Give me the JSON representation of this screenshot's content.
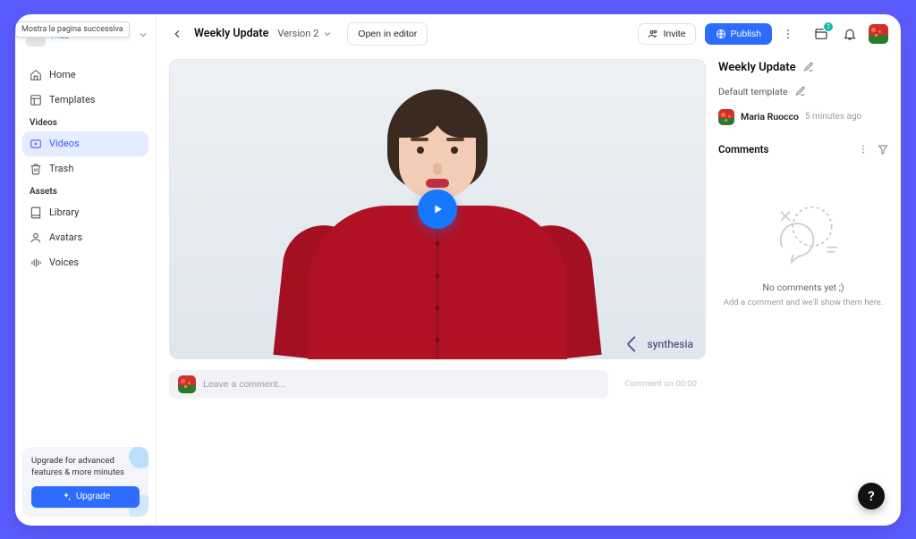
{
  "tooltip": "Mostra la pagina successiva",
  "workspace": {
    "plan": "FREE"
  },
  "nav": {
    "home": "Home",
    "templates": "Templates",
    "videos_heading": "Videos",
    "videos": "Videos",
    "trash": "Trash",
    "assets_heading": "Assets",
    "library": "Library",
    "avatars": "Avatars",
    "voices": "Voices"
  },
  "upgrade": {
    "text": "Upgrade for advanced features & more minutes",
    "button": "Upgrade"
  },
  "topbar": {
    "title": "Weekly Update",
    "version": "Version 2",
    "open_in_editor": "Open in editor",
    "invite": "Invite",
    "publish": "Publish",
    "notification_count": "1"
  },
  "video": {
    "watermark": "synthesia"
  },
  "comment_box": {
    "placeholder": "Leave a comment...",
    "timestamp_hint": "Comment on 00:00"
  },
  "rightpanel": {
    "title": "Weekly Update",
    "template": "Default template",
    "author": "Maria Ruocco",
    "ago": "5 minutes ago",
    "comments_heading": "Comments",
    "empty_title": "No comments yet ;)",
    "empty_sub": "Add a comment and we'll show them here."
  },
  "help": "?"
}
